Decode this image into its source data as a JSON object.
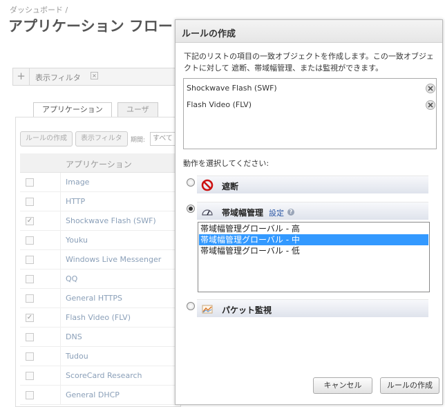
{
  "background": {
    "breadcrumb": "ダッシュボード /",
    "page_title": "アプリケーション フロー",
    "filter_add": "+",
    "filter_label": "表示フィルタ",
    "filter_clear": "×",
    "tabs": [
      {
        "label": "アプリケーション",
        "active": true
      },
      {
        "label": "ユーザ",
        "active": false
      }
    ],
    "toolbar": {
      "create_rule_label": "ルールの作成",
      "show_filter_label": "表示フィルタ",
      "period_label": "期間:",
      "period_value": "すべて"
    },
    "table": {
      "column_header": "アプリケーション",
      "rows": [
        {
          "name": "Image",
          "checked": false
        },
        {
          "name": "HTTP",
          "checked": false
        },
        {
          "name": "Shockwave Flash (SWF)",
          "checked": true
        },
        {
          "name": "Youku",
          "checked": false
        },
        {
          "name": "Windows Live Messenger",
          "checked": false
        },
        {
          "name": "QQ",
          "checked": false
        },
        {
          "name": "General HTTPS",
          "checked": false
        },
        {
          "name": "Flash Video (FLV)",
          "checked": true
        },
        {
          "name": "DNS",
          "checked": false
        },
        {
          "name": "Tudou",
          "checked": false
        },
        {
          "name": "ScoreCard Research",
          "checked": false
        },
        {
          "name": "General DHCP",
          "checked": false
        }
      ]
    }
  },
  "modal": {
    "title": "ルールの作成",
    "description": "下記のリストの項目の一致オブジェクトを作成します。この一致オブジェクトに対して 遮断、帯域幅管理、または監視ができます。",
    "objects": [
      {
        "label": "Shockwave Flash (SWF)"
      },
      {
        "label": "Flash Video (FLV)"
      }
    ],
    "action_prompt": "動作を選択してください:",
    "options": {
      "block": {
        "label": "遮断",
        "icon": "block-icon",
        "selected": false
      },
      "bandwidth": {
        "label": "帯域幅管理",
        "icon": "gauge-icon",
        "selected": true,
        "settings_link": "設定",
        "help": "?"
      },
      "monitor": {
        "label": "パケット監視",
        "icon": "chart-icon",
        "selected": false
      }
    },
    "bandwidth_levels": [
      {
        "label": "帯域幅管理グローバル - 高",
        "selected": false
      },
      {
        "label": "帯域幅管理グローバル - 中",
        "selected": true
      },
      {
        "label": "帯域幅管理グローバル - 低",
        "selected": false
      }
    ],
    "cancel_label": "キャンセル",
    "create_label": "ルールの作成"
  },
  "colors": {
    "selection": "#3399ff",
    "link": "#2a56a5",
    "block_red": "#cc1111"
  }
}
